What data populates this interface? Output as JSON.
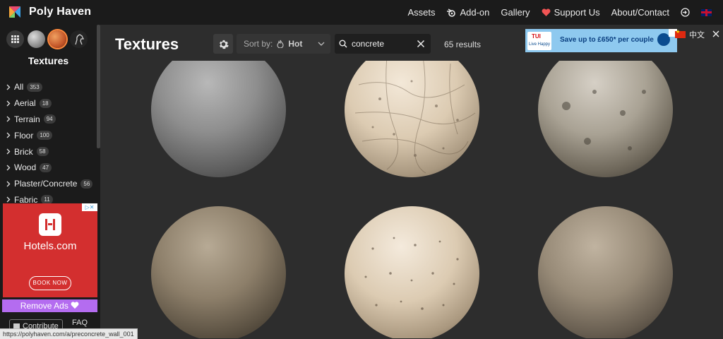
{
  "header": {
    "brand": "Poly Haven",
    "nav": [
      {
        "label": "Assets",
        "icon": ""
      },
      {
        "label": "Add-on",
        "icon": "blender-icon"
      },
      {
        "label": "Gallery",
        "icon": ""
      },
      {
        "label": "Support Us",
        "icon": "heart-icon"
      },
      {
        "label": "About/Contact",
        "icon": ""
      }
    ]
  },
  "sidebar": {
    "title": "Textures",
    "categories": [
      {
        "label": "All",
        "count": "353"
      },
      {
        "label": "Aerial",
        "count": "18"
      },
      {
        "label": "Terrain",
        "count": "94"
      },
      {
        "label": "Floor",
        "count": "100"
      },
      {
        "label": "Brick",
        "count": "58"
      },
      {
        "label": "Wood",
        "count": "47"
      },
      {
        "label": "Plaster/Concrete",
        "count": "56"
      },
      {
        "label": "Fabric",
        "count": "11"
      }
    ],
    "remove_ads": "Remove Ads",
    "contribute": "Contribute",
    "faq": "FAQ"
  },
  "ads": {
    "hotels_name": "Hotels.com",
    "hotels_cta": "BOOK NOW",
    "tui_brand": "TUI",
    "tui_tag": "Live Happy",
    "tui_text": "Save up to £650* per couple"
  },
  "toolbar": {
    "page_title": "Textures",
    "sort_label": "Sort by:",
    "sort_value": "Hot",
    "search_value": "concrete",
    "results": "65 results"
  },
  "lang": {
    "label": "中文"
  },
  "status_bar": {
    "url": "https://polyhaven.com/a/preconcrete_wall_001"
  },
  "colors": {
    "accent": "#ff8a3d",
    "remove_ads": "#b46cf0",
    "hotels_red": "#d32f2f",
    "tui_blue": "#8ec9ef"
  }
}
